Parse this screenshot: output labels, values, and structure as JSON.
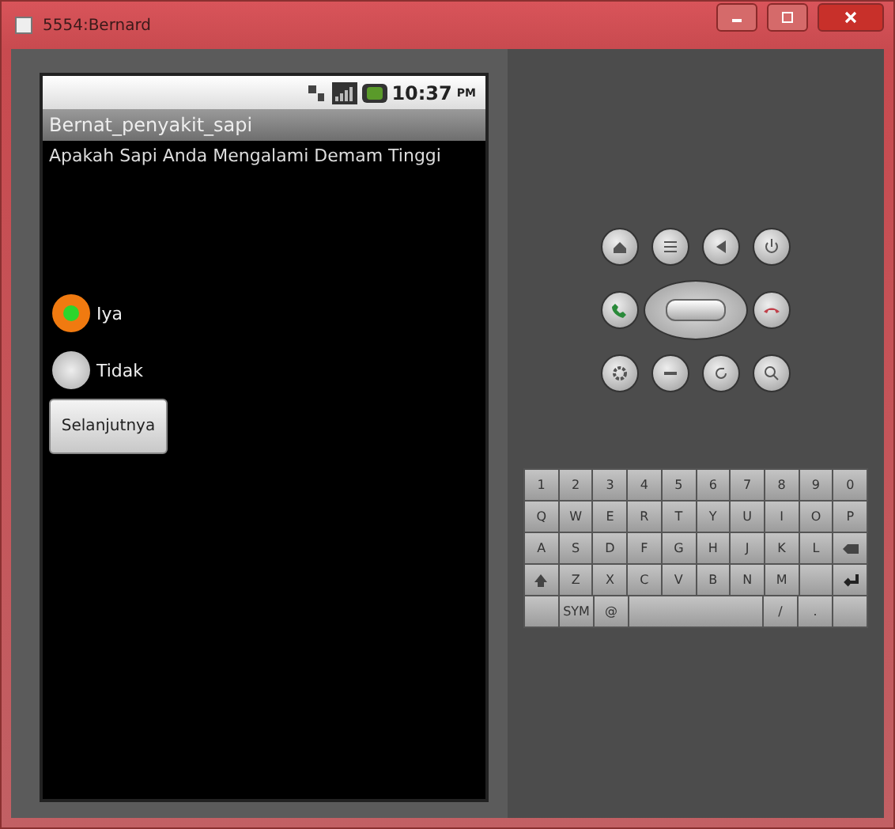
{
  "window": {
    "title": "5554:Bernard"
  },
  "status_bar": {
    "time": "10:37",
    "meridiem": "PM"
  },
  "app": {
    "title": "Bernat_penyakit_sapi",
    "question": "Apakah Sapi Anda Mengalami Demam Tinggi",
    "options": [
      {
        "label": "Iya",
        "selected": true
      },
      {
        "label": "Tidak",
        "selected": false
      }
    ],
    "button": "Selanjutnya"
  },
  "keyboard": {
    "rows": [
      [
        {
          "kind": "char",
          "label": "1"
        },
        {
          "kind": "char",
          "label": "2"
        },
        {
          "kind": "char",
          "label": "3"
        },
        {
          "kind": "char",
          "label": "4"
        },
        {
          "kind": "char",
          "label": "5"
        },
        {
          "kind": "char",
          "label": "6"
        },
        {
          "kind": "char",
          "label": "7"
        },
        {
          "kind": "char",
          "label": "8"
        },
        {
          "kind": "char",
          "label": "9"
        },
        {
          "kind": "char",
          "label": "0"
        }
      ],
      [
        {
          "kind": "char",
          "label": "Q"
        },
        {
          "kind": "char",
          "label": "W"
        },
        {
          "kind": "char",
          "label": "E"
        },
        {
          "kind": "char",
          "label": "R"
        },
        {
          "kind": "char",
          "label": "T"
        },
        {
          "kind": "char",
          "label": "Y"
        },
        {
          "kind": "char",
          "label": "U"
        },
        {
          "kind": "char",
          "label": "I"
        },
        {
          "kind": "char",
          "label": "O"
        },
        {
          "kind": "char",
          "label": "P"
        }
      ],
      [
        {
          "kind": "char",
          "label": "A"
        },
        {
          "kind": "char",
          "label": "S"
        },
        {
          "kind": "char",
          "label": "D"
        },
        {
          "kind": "char",
          "label": "F"
        },
        {
          "kind": "char",
          "label": "G"
        },
        {
          "kind": "char",
          "label": "H"
        },
        {
          "kind": "char",
          "label": "J"
        },
        {
          "kind": "char",
          "label": "K"
        },
        {
          "kind": "char",
          "label": "L"
        },
        {
          "kind": "delete"
        }
      ],
      [
        {
          "kind": "shift"
        },
        {
          "kind": "char",
          "label": "Z"
        },
        {
          "kind": "char",
          "label": "X"
        },
        {
          "kind": "char",
          "label": "C"
        },
        {
          "kind": "char",
          "label": "V"
        },
        {
          "kind": "char",
          "label": "B"
        },
        {
          "kind": "char",
          "label": "N"
        },
        {
          "kind": "char",
          "label": "M"
        },
        {
          "kind": "blank"
        },
        {
          "kind": "enter"
        }
      ]
    ],
    "bottom_row": [
      {
        "kind": "blank"
      },
      {
        "kind": "char",
        "label": "SYM"
      },
      {
        "kind": "char",
        "label": "@"
      },
      {
        "kind": "space"
      },
      {
        "kind": "char",
        "label": "/"
      },
      {
        "kind": "char",
        "label": "."
      },
      {
        "kind": "blank"
      }
    ]
  }
}
